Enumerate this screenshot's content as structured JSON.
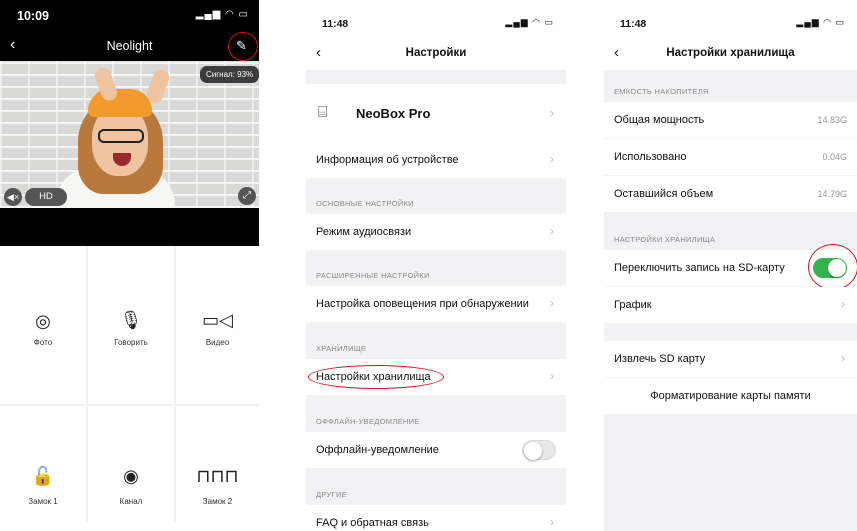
{
  "screen1": {
    "time": "10:09",
    "title": "Neolight",
    "signal": "Сигнал: 93%",
    "hd": "HD",
    "grid": [
      {
        "label": "Фото",
        "icon": "camera-icon"
      },
      {
        "label": "Говорить",
        "icon": "microphone-icon"
      },
      {
        "label": "Видео",
        "icon": "video-camera-icon"
      },
      {
        "label": "Замок 1",
        "icon": "lock-icon"
      },
      {
        "label": "Канал",
        "icon": "eye-icon"
      },
      {
        "label": "Замок 2",
        "icon": "gate-icon"
      }
    ]
  },
  "screen2": {
    "time": "11:48",
    "title": "Настройки",
    "device_name": "NeoBox Pro",
    "device_info": "Информация об устройстве",
    "section_basic": "ОСНОВНЫЕ НАСТРОЙКИ",
    "audio_mode": "Режим аудиосвязи",
    "section_advanced": "РАСШИРЕННЫЕ НАСТРОЙКИ",
    "detection_alert": "Настройка оповещения при обнаружении",
    "section_storage": "ХРАНИЛИЩЕ",
    "storage_settings": "Настройки хранилища",
    "section_offline": "ОФФЛАЙН-УВЕДОМЛЕНИЕ",
    "offline_notification": "Оффлайн-уведомление",
    "offline_enabled": false,
    "section_other": "ДРУГИЕ",
    "faq": "FAQ и обратная связь"
  },
  "screen3": {
    "time": "11:48",
    "title": "Настройки хранилища",
    "section_capacity": "ЕМКОСТЬ НАКОПИТЕЛЯ",
    "total_label": "Общая мощность",
    "total_value": "14.83G",
    "used_label": "Использовано",
    "used_value": "0.04G",
    "remaining_label": "Оставшийся объем",
    "remaining_value": "14.79G",
    "section_storage": "НАСТРОЙКИ ХРАНИЛИЩА",
    "sd_record_label": "Переключить запись на SD-карту",
    "sd_record_enabled": true,
    "schedule_label": "График",
    "eject_label": "Извлечь SD карту",
    "format_label": "Форматирование карты памяти"
  },
  "colors": {
    "toggle_on": "#31b54a",
    "annotation": "#d2161b"
  }
}
